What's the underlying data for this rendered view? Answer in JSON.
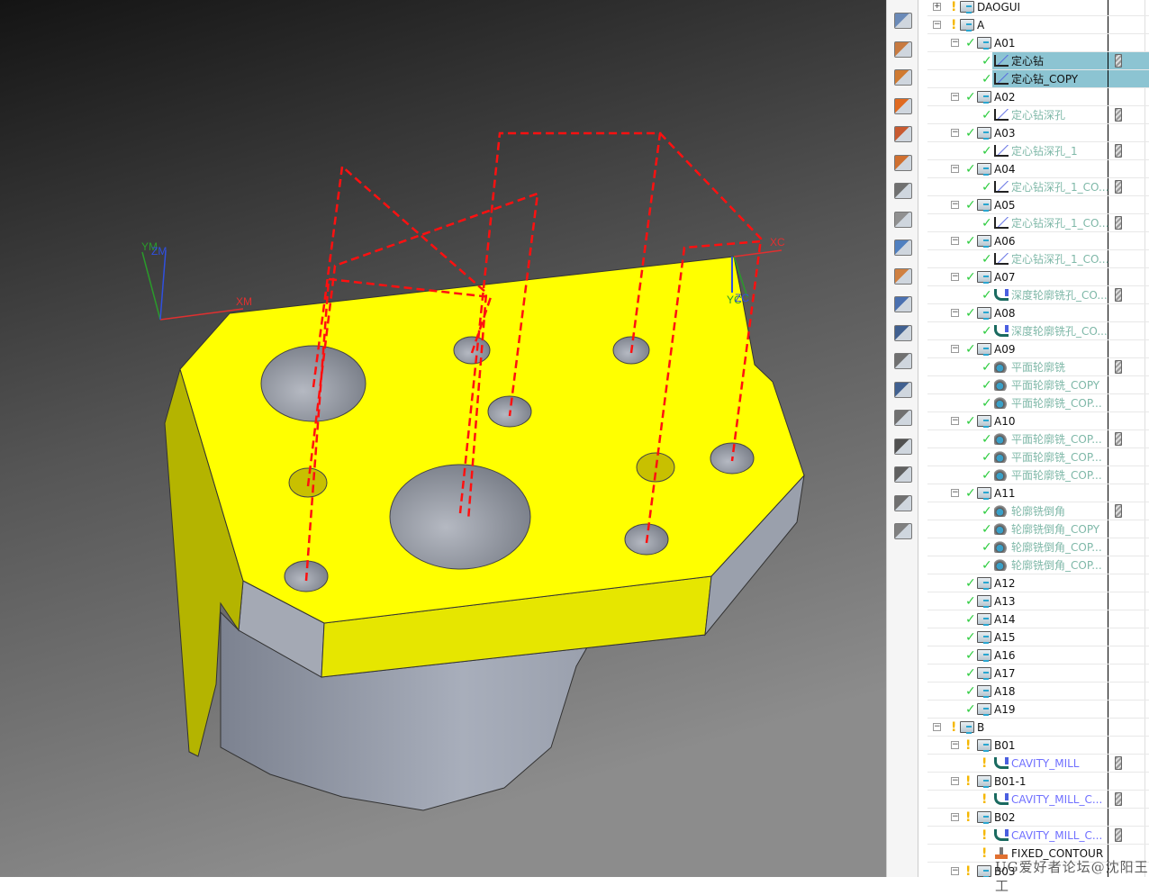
{
  "viewport": {
    "axes": {
      "ym": "YM",
      "zm": "ZM",
      "xm": "XM",
      "xc": "XC",
      "yc": "YC",
      "zc": "ZC"
    },
    "colors": {
      "part_top": "#ffff00",
      "part_side": "#b0b000",
      "part_gray": "#9aa0ac",
      "toolpath": "#ff1010",
      "background_top": "#1a1a1a",
      "background_bottom": "#8a8a8a"
    }
  },
  "toolbar": {
    "icons": [
      "machine-tool-icon",
      "create-program-icon",
      "create-tool-icon",
      "create-geometry-icon",
      "create-method-icon",
      "create-operation-icon",
      "verify-icon",
      "edit-object-icon",
      "tool-path-icon",
      "cut-method-icon",
      "feeds-icon",
      "simulate-icon",
      "shop-doc-icon",
      "post-process-icon",
      "output-cls-icon",
      "save-icon",
      "show-icon",
      "hide-icon",
      "gouge-check-icon"
    ]
  },
  "tree": {
    "rows": [
      {
        "label": "DAOGUI",
        "level": 0,
        "expander": "+",
        "status": "warn",
        "icon": "folder",
        "style": "grp"
      },
      {
        "label": "A",
        "level": 0,
        "expander": "-",
        "status": "warn",
        "icon": "folder",
        "style": "grp"
      },
      {
        "label": "A01",
        "level": 1,
        "expander": "-",
        "status": "ok",
        "icon": "folder",
        "style": "grp"
      },
      {
        "label": "定心钻",
        "level": 2,
        "status": "ok",
        "icon": "op",
        "style": "dark",
        "tool": true,
        "selected": true
      },
      {
        "label": "定心钻_COPY",
        "level": 2,
        "status": "ok",
        "icon": "op",
        "style": "dark",
        "selected": true
      },
      {
        "label": "A02",
        "level": 1,
        "expander": "-",
        "status": "ok",
        "icon": "folder",
        "style": "grp"
      },
      {
        "label": "定心钻深孔",
        "level": 2,
        "status": "ok",
        "icon": "op",
        "style": "dim",
        "tool": true
      },
      {
        "label": "A03",
        "level": 1,
        "expander": "-",
        "status": "ok",
        "icon": "folder",
        "style": "grp"
      },
      {
        "label": "定心钻深孔_1",
        "level": 2,
        "status": "ok",
        "icon": "op",
        "style": "dim",
        "tool": true
      },
      {
        "label": "A04",
        "level": 1,
        "expander": "-",
        "status": "ok",
        "icon": "folder",
        "style": "grp"
      },
      {
        "label": "定心钻深孔_1_CO...",
        "level": 2,
        "status": "ok",
        "icon": "op",
        "style": "dim",
        "tool": true
      },
      {
        "label": "A05",
        "level": 1,
        "expander": "-",
        "status": "ok",
        "icon": "folder",
        "style": "grp"
      },
      {
        "label": "定心钻深孔_1_CO...",
        "level": 2,
        "status": "ok",
        "icon": "op",
        "style": "dim",
        "tool": true
      },
      {
        "label": "A06",
        "level": 1,
        "expander": "-",
        "status": "ok",
        "icon": "folder",
        "style": "grp"
      },
      {
        "label": "定心钻深孔_1_CO...",
        "level": 2,
        "status": "ok",
        "icon": "op",
        "style": "dim"
      },
      {
        "label": "A07",
        "level": 1,
        "expander": "-",
        "status": "ok",
        "icon": "folder",
        "style": "grp"
      },
      {
        "label": "深度轮廓铣孔_CO...",
        "level": 2,
        "status": "ok",
        "icon": "cav",
        "style": "dim",
        "tool": true
      },
      {
        "label": "A08",
        "level": 1,
        "expander": "-",
        "status": "ok",
        "icon": "folder",
        "style": "grp"
      },
      {
        "label": "深度轮廓铣孔_CO...",
        "level": 2,
        "status": "ok",
        "icon": "cav",
        "style": "dim"
      },
      {
        "label": "A09",
        "level": 1,
        "expander": "-",
        "status": "ok",
        "icon": "folder",
        "style": "grp"
      },
      {
        "label": "平面轮廓铣",
        "level": 2,
        "status": "ok",
        "icon": "mill",
        "style": "dim",
        "tool": true
      },
      {
        "label": "平面轮廓铣_COPY",
        "level": 2,
        "status": "ok",
        "icon": "mill",
        "style": "dim"
      },
      {
        "label": "平面轮廓铣_COP...",
        "level": 2,
        "status": "ok",
        "icon": "mill",
        "style": "dim"
      },
      {
        "label": "A10",
        "level": 1,
        "expander": "-",
        "status": "ok",
        "icon": "folder",
        "style": "grp"
      },
      {
        "label": "平面轮廓铣_COP...",
        "level": 2,
        "status": "ok",
        "icon": "mill",
        "style": "dim",
        "tool": true
      },
      {
        "label": "平面轮廓铣_COP...",
        "level": 2,
        "status": "ok",
        "icon": "mill",
        "style": "dim"
      },
      {
        "label": "平面轮廓铣_COP...",
        "level": 2,
        "status": "ok",
        "icon": "mill",
        "style": "dim"
      },
      {
        "label": "A11",
        "level": 1,
        "expander": "-",
        "status": "ok",
        "icon": "folder",
        "style": "grp"
      },
      {
        "label": "轮廓铣倒角",
        "level": 2,
        "status": "ok",
        "icon": "mill",
        "style": "dim",
        "tool": true
      },
      {
        "label": "轮廓铣倒角_COPY",
        "level": 2,
        "status": "ok",
        "icon": "mill",
        "style": "dim"
      },
      {
        "label": "轮廓铣倒角_COP...",
        "level": 2,
        "status": "ok",
        "icon": "mill",
        "style": "dim"
      },
      {
        "label": "轮廓铣倒角_COP...",
        "level": 2,
        "status": "ok",
        "icon": "mill",
        "style": "dim"
      },
      {
        "label": "A12",
        "level": 1,
        "status": "ok",
        "icon": "folder",
        "style": "grp"
      },
      {
        "label": "A13",
        "level": 1,
        "status": "ok",
        "icon": "folder",
        "style": "grp"
      },
      {
        "label": "A14",
        "level": 1,
        "status": "ok",
        "icon": "folder",
        "style": "grp"
      },
      {
        "label": "A15",
        "level": 1,
        "status": "ok",
        "icon": "folder",
        "style": "grp"
      },
      {
        "label": "A16",
        "level": 1,
        "status": "ok",
        "icon": "folder",
        "style": "grp"
      },
      {
        "label": "A17",
        "level": 1,
        "status": "ok",
        "icon": "folder",
        "style": "grp"
      },
      {
        "label": "A18",
        "level": 1,
        "status": "ok",
        "icon": "folder",
        "style": "grp"
      },
      {
        "label": "A19",
        "level": 1,
        "status": "ok",
        "icon": "folder",
        "style": "grp"
      },
      {
        "label": "B",
        "level": 0,
        "expander": "-",
        "status": "warn",
        "icon": "folder",
        "style": "grp"
      },
      {
        "label": "B01",
        "level": 1,
        "expander": "-",
        "status": "warn",
        "icon": "folder",
        "style": "grp"
      },
      {
        "label": "CAVITY_MILL",
        "level": 2,
        "status": "warn",
        "icon": "cav",
        "style": "blue",
        "tool": true
      },
      {
        "label": "B01-1",
        "level": 1,
        "expander": "-",
        "status": "warn",
        "icon": "folder",
        "style": "grp"
      },
      {
        "label": "CAVITY_MILL_C...",
        "level": 2,
        "status": "warn",
        "icon": "cav",
        "style": "blue",
        "tool": true
      },
      {
        "label": "B02",
        "level": 1,
        "expander": "-",
        "status": "warn",
        "icon": "folder",
        "style": "grp"
      },
      {
        "label": "CAVITY_MILL_C...",
        "level": 2,
        "status": "warn",
        "icon": "cav",
        "style": "blue",
        "tool": true
      },
      {
        "label": "FIXED_CONTOUR",
        "level": 2,
        "status": "warn",
        "icon": "fix",
        "style": "dark"
      },
      {
        "label": "B03",
        "level": 1,
        "expander": "-",
        "status": "warn",
        "icon": "folder",
        "style": "grp"
      }
    ]
  },
  "watermark": "UG爱好者论坛@沈阳王工"
}
